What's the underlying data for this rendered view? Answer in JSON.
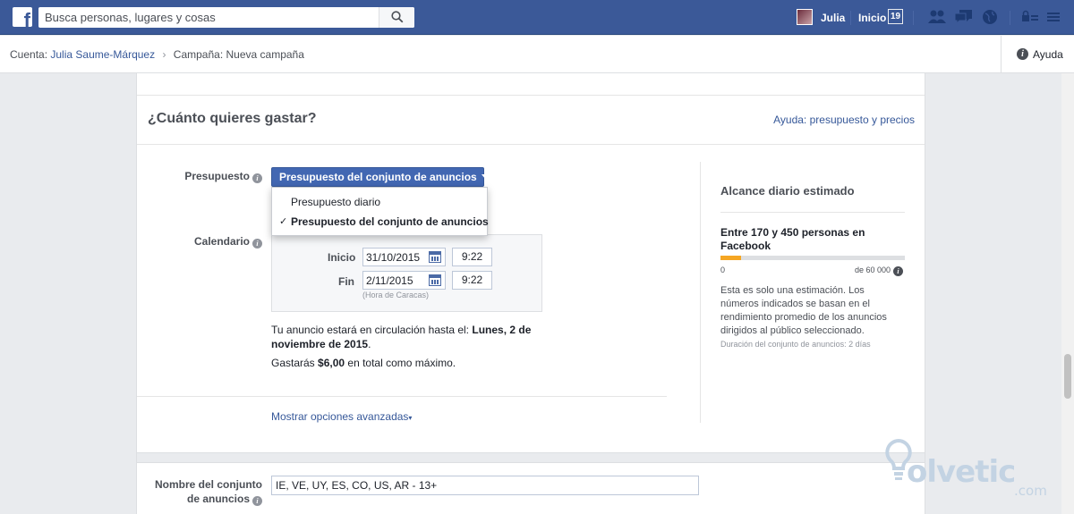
{
  "topbar": {
    "logo_icon": "f",
    "search_placeholder": "Busca personas, lugares y cosas",
    "user_name": "Julia",
    "home_label": "Inicio",
    "home_count": "19"
  },
  "breadcrumb": {
    "account_label": "Cuenta:",
    "account_name": "Julia Saume-Márquez",
    "campaign_label": "Campaña:",
    "campaign_name": "Nueva campaña",
    "help_label": "Ayuda"
  },
  "budget_section": {
    "title": "¿Cuánto quieres gastar?",
    "help_link": "Ayuda: presupuesto y precios",
    "budget_label": "Presupuesto",
    "budget_selected": "Presupuesto del conjunto de anuncios",
    "budget_options": [
      {
        "label": "Presupuesto diario",
        "selected": false
      },
      {
        "label": "Presupuesto del conjunto de anuncios",
        "selected": true
      }
    ],
    "schedule_label": "Calendario",
    "start_label": "Inicio",
    "start_date": "31/10/2015",
    "start_time": "9:22",
    "end_label": "Fin",
    "end_date": "2/11/2015",
    "end_time": "9:22",
    "timezone_note": "(Hora de Caracas)",
    "run_text_prefix": "Tu anuncio estará en circulación hasta el: ",
    "run_text_date": "Lunes, 2 de noviembre de 2015",
    "run_text_suffix": ".",
    "spend_prefix": "Gastarás ",
    "spend_amount": "$6,00",
    "spend_suffix": " en total como máximo.",
    "advanced_link": "Mostrar opciones avanzadas"
  },
  "estimate": {
    "title": "Alcance diario estimado",
    "range": "Entre 170 y 450 personas en Facebook",
    "bar_min_label": "0",
    "bar_max_label": "de 60 000",
    "bar_fill_fraction": 0.11,
    "note": "Esta es solo una estimación. Los números indicados se basan en el rendimiento promedio de los anuncios dirigidos al público seleccionado.",
    "duration": "Duración del conjunto de anuncios: 2 días"
  },
  "adset": {
    "name_label_1": "Nombre del conjunto",
    "name_label_2": "de anuncios",
    "name_value": "IE, VE, UY, ES, CO, US, AR - 13+"
  },
  "watermark": {
    "text": "olvetic",
    "suffix": ".com"
  },
  "colors": {
    "brand": "#3b5998",
    "button": "#4267b2",
    "link": "#365899",
    "bar_fill": "#f5a623"
  }
}
